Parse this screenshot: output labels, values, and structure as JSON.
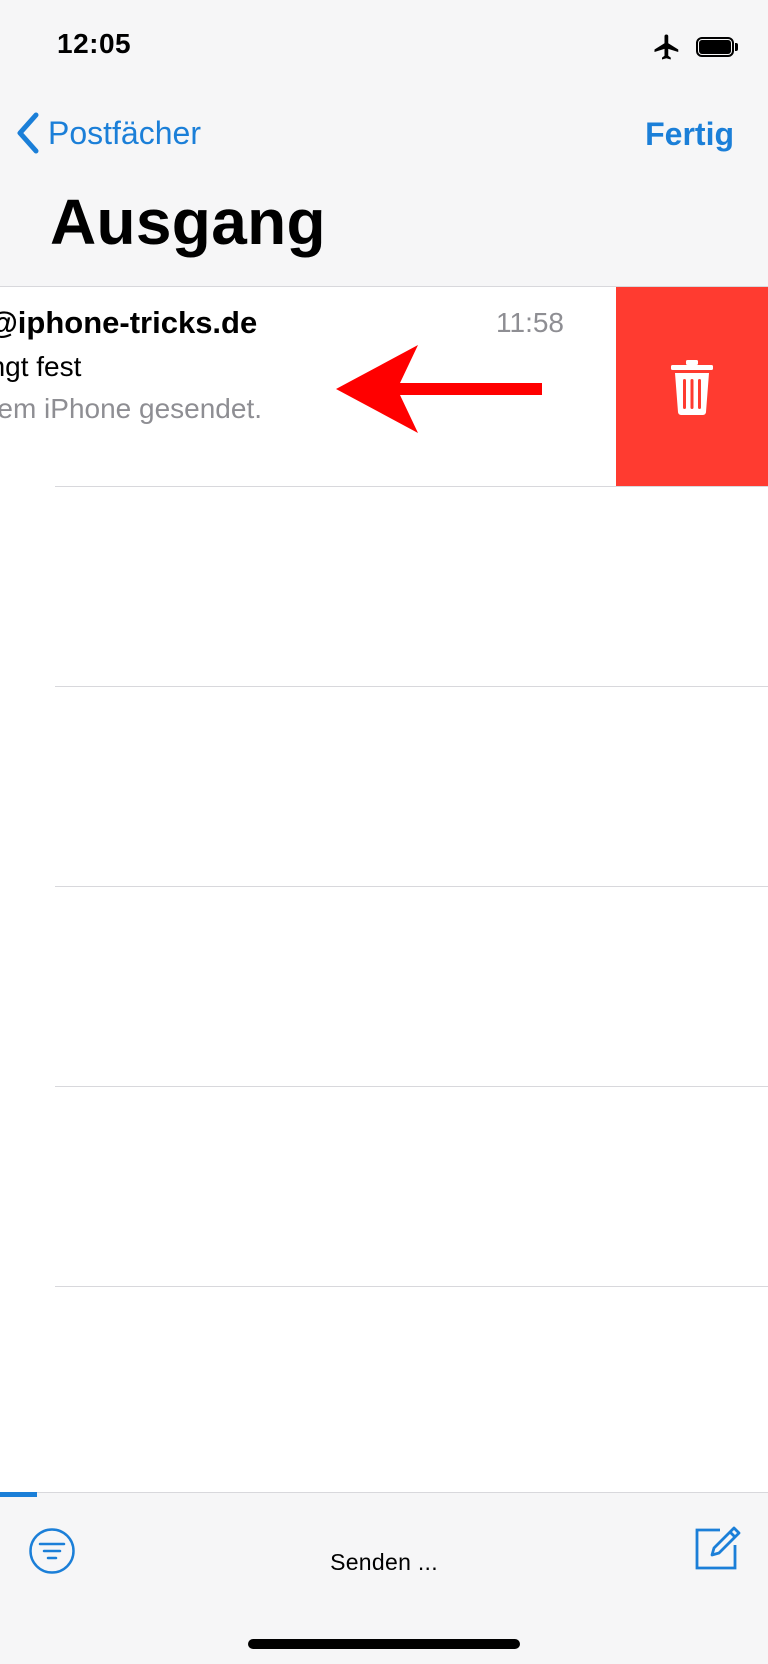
{
  "status_bar": {
    "time": "12:05",
    "icons": [
      "airplane-icon",
      "battery-icon"
    ]
  },
  "nav": {
    "back_label": "Postfächer",
    "done_label": "Fertig"
  },
  "title": "Ausgang",
  "mail": {
    "sender": "kt@iphone-tricks.de",
    "time": "11:58",
    "subject": "ängt fest",
    "preview": "einem iPhone gesendet."
  },
  "swipe_action": {
    "icon": "trash-icon",
    "color": "#ff3b30"
  },
  "annotation": {
    "icon": "red-arrow-left-icon",
    "color": "#ff0000"
  },
  "toolbar": {
    "status": "Senden ...",
    "progress": 0.048,
    "filter_icon": "filter-icon",
    "compose_icon": "compose-icon"
  },
  "colors": {
    "accent": "#1b7fd8",
    "destructive": "#ff3b30",
    "secondary_text": "#8e8e93"
  }
}
